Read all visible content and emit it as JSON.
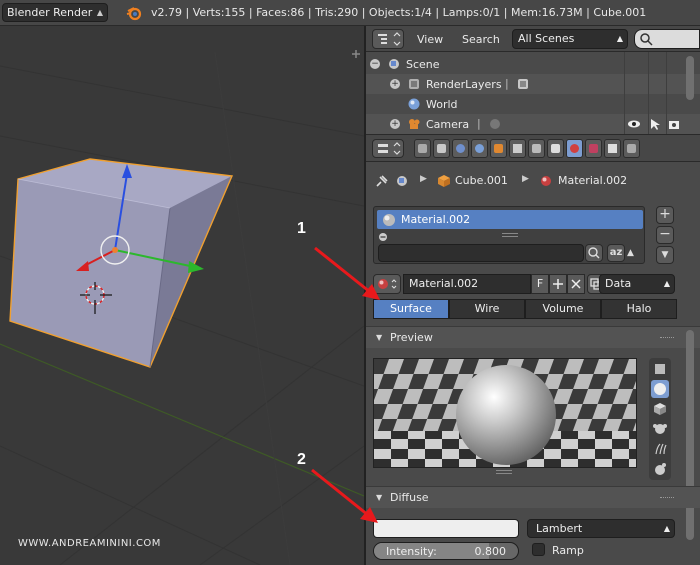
{
  "header": {
    "engine": "Blender Render",
    "stats": "v2.79 | Verts:155 | Faces:86 | Tris:290 | Objects:1/4 | Lamps:0/1 | Mem:16.73M | Cube.001"
  },
  "viewport": {
    "watermark": "WWW.ANDREAMININI.COM"
  },
  "outliner": {
    "menu_view": "View",
    "menu_search": "Search",
    "scenes_select": "All Scenes",
    "rows": [
      {
        "label": "Scene"
      },
      {
        "label": "RenderLayers"
      },
      {
        "label": "World"
      },
      {
        "label": "Camera"
      }
    ]
  },
  "properties": {
    "breadcrumb": {
      "object": "Cube.001",
      "material": "Material.002"
    },
    "material_slot": "Material.002",
    "material_name": "Material.002",
    "users_label": "F",
    "link_select": "Data",
    "shading_tabs": [
      {
        "label": "Surface",
        "active": true
      },
      {
        "label": "Wire"
      },
      {
        "label": "Volume"
      },
      {
        "label": "Halo"
      }
    ],
    "preview_panel": "Preview",
    "diffuse_panel": "Diffuse",
    "diffuse_shader": "Lambert",
    "intensity_label": "Intensity:",
    "intensity_value": "0.800",
    "intensity_fraction": 0.8,
    "ramp_label": "Ramp",
    "sort_label": "az"
  },
  "annotations": {
    "one": "1",
    "two": "2"
  },
  "colors": {
    "accent": "#5680c2",
    "arrow": "#e8191c",
    "selection": "#f0a030"
  }
}
